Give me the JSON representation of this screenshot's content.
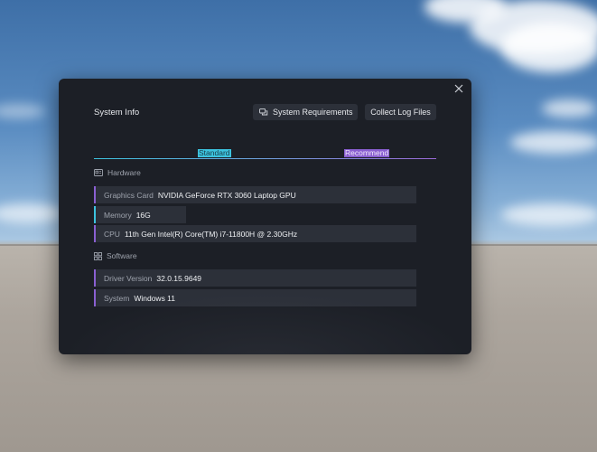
{
  "dialog": {
    "title": "System Info",
    "buttons": {
      "system_requirements": "System Requirements",
      "collect_logs": "Collect Log Files"
    },
    "tabs": [
      {
        "label": "Standard",
        "color": "#3cc3de"
      },
      {
        "label": "Recommend",
        "color": "#8a5fd1"
      }
    ],
    "hardware": {
      "heading": "Hardware",
      "icon": "hardware-icon",
      "rows": [
        {
          "label": "Graphics Card",
          "value": "NVIDIA GeForce RTX 3060 Laptop GPU"
        },
        {
          "label": "Memory",
          "value": "16G"
        },
        {
          "label": "CPU",
          "value": "11th Gen Intel(R) Core(TM) i7-11800H @ 2.30GHz"
        }
      ]
    },
    "software": {
      "heading": "Software",
      "icon": "software-icon",
      "rows": [
        {
          "label": "Driver Version",
          "value": "32.0.15.9649"
        },
        {
          "label": "System",
          "value": "Windows 11"
        }
      ]
    }
  },
  "colors": {
    "background": "#1c1f26",
    "row_background": "#2c3039",
    "accent_purple": "#8a5fd1",
    "accent_cyan": "#3cc3de"
  }
}
